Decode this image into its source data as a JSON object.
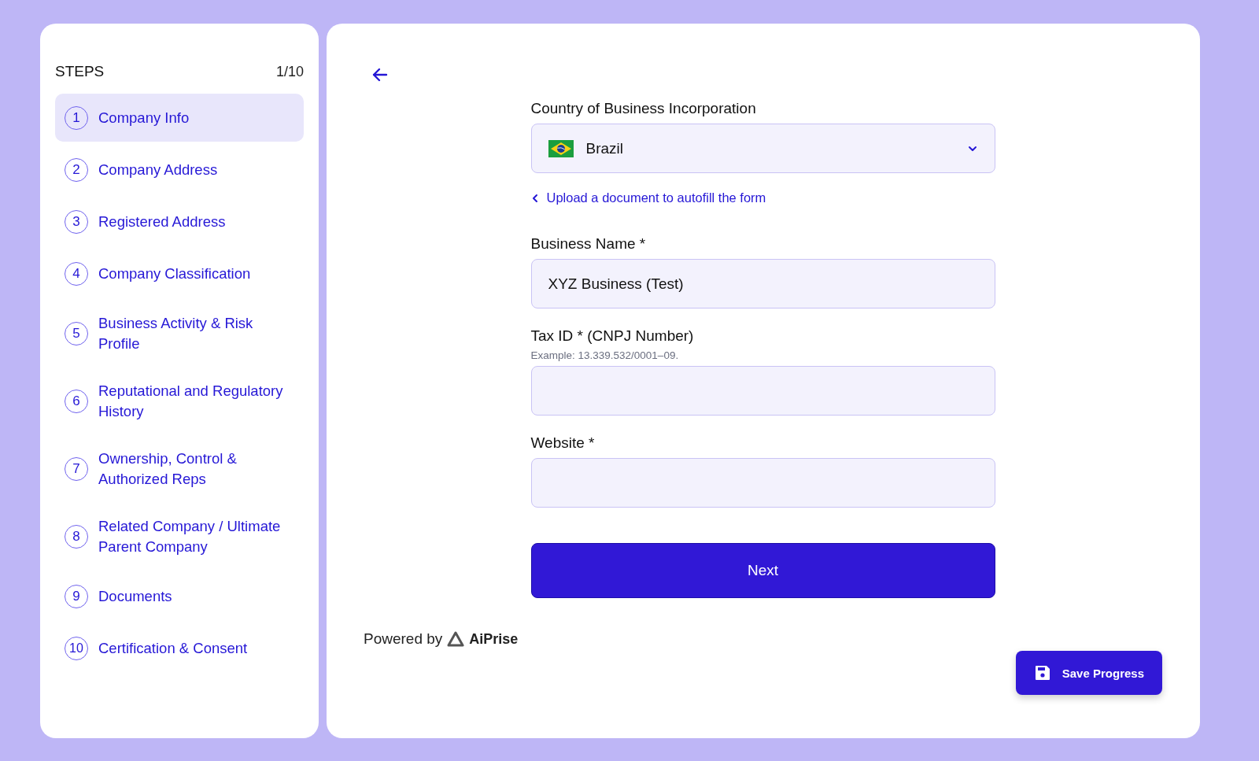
{
  "sidebar": {
    "title": "STEPS",
    "counter": "1/10",
    "steps": [
      {
        "number": "1",
        "label": "Company Info",
        "selected": true
      },
      {
        "number": "2",
        "label": "Company Address",
        "selected": false
      },
      {
        "number": "3",
        "label": "Registered Address",
        "selected": false
      },
      {
        "number": "4",
        "label": "Company Classification",
        "selected": false
      },
      {
        "number": "5",
        "label": "Business Activity & Risk Profile",
        "selected": false
      },
      {
        "number": "6",
        "label": "Reputational and Regulatory History",
        "selected": false
      },
      {
        "number": "7",
        "label": "Ownership, Control & Authorized Reps",
        "selected": false
      },
      {
        "number": "8",
        "label": "Related Company / Ultimate Parent Company",
        "selected": false
      },
      {
        "number": "9",
        "label": "Documents",
        "selected": false
      },
      {
        "number": "10",
        "label": "Certification & Consent",
        "selected": false
      }
    ]
  },
  "form": {
    "country": {
      "label": "Country of Business Incorporation",
      "value": "Brazil"
    },
    "upload_link": "Upload a document to autofill the form",
    "fields": [
      {
        "label": "Business Name *",
        "value": "XYZ Business (Test)"
      },
      {
        "label": "Tax ID * (CNPJ Number)",
        "hint": "Example: 13.339.532/0001–09."
      },
      {
        "label": "Website *"
      }
    ],
    "next_button": "Next"
  },
  "footer": {
    "powered_by": "Powered by",
    "brand": "AiPrise"
  },
  "save_button": "Save Progress"
}
